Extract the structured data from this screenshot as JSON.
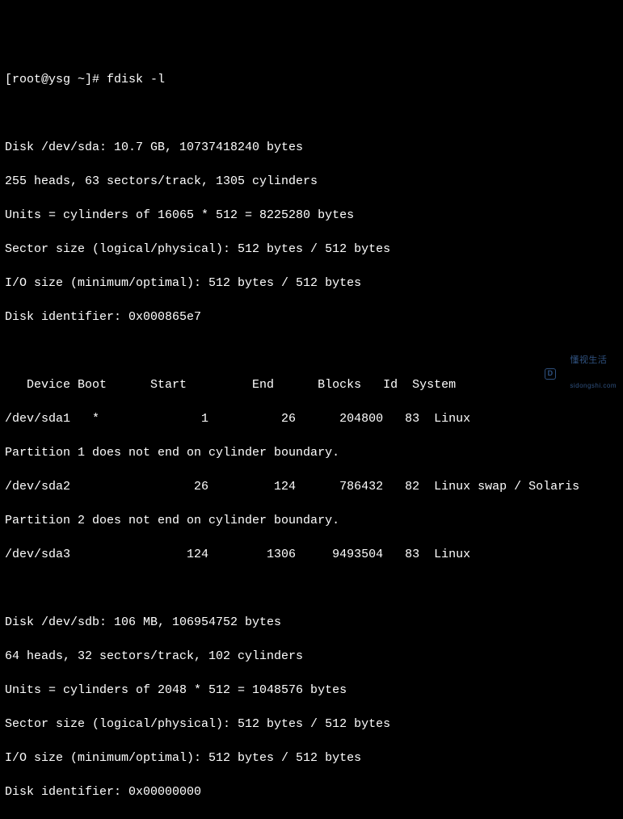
{
  "prompt": {
    "user_host": "[root@ysg ~]#",
    "command": "fdisk -l"
  },
  "disk_sda": {
    "header": "Disk /dev/sda: 10.7 GB, 10737418240 bytes",
    "geometry": "255 heads, 63 sectors/track, 1305 cylinders",
    "units": "Units = cylinders of 16065 * 512 = 8225280 bytes",
    "sector": "Sector size (logical/physical): 512 bytes / 512 bytes",
    "io": "I/O size (minimum/optimal): 512 bytes / 512 bytes",
    "identifier": "Disk identifier: 0x000865e7"
  },
  "partitions": {
    "header": {
      "device": "Device",
      "boot": "Boot",
      "start": "Start",
      "end": "End",
      "blocks": "Blocks",
      "id": "Id",
      "system": "System"
    },
    "rows": [
      {
        "device": "/dev/sda1",
        "boot": "*",
        "start": "1",
        "end": "26",
        "blocks": "204800",
        "id": "83",
        "system": "Linux"
      },
      {
        "device": "/dev/sda2",
        "boot": "",
        "start": "26",
        "end": "124",
        "blocks": "786432",
        "id": "82",
        "system": "Linux swap / Solaris"
      },
      {
        "device": "/dev/sda3",
        "boot": "",
        "start": "124",
        "end": "1306",
        "blocks": "9493504",
        "id": "83",
        "system": "Linux"
      }
    ],
    "warnings": {
      "w1": "Partition 1 does not end on cylinder boundary.",
      "w2": "Partition 2 does not end on cylinder boundary."
    }
  },
  "disk_sdb": {
    "header": "Disk /dev/sdb: 106 MB, 106954752 bytes",
    "geometry": "64 heads, 32 sectors/track, 102 cylinders",
    "units": "Units = cylinders of 2048 * 512 = 1048576 bytes",
    "sector": "Sector size (logical/physical): 512 bytes / 512 bytes",
    "io": "I/O size (minimum/optimal): 512 bytes / 512 bytes",
    "identifier": "Disk identifier: 0x00000000"
  },
  "watermark": {
    "icon": "D",
    "text": "懂视生活",
    "url": "sidongshi.com"
  }
}
